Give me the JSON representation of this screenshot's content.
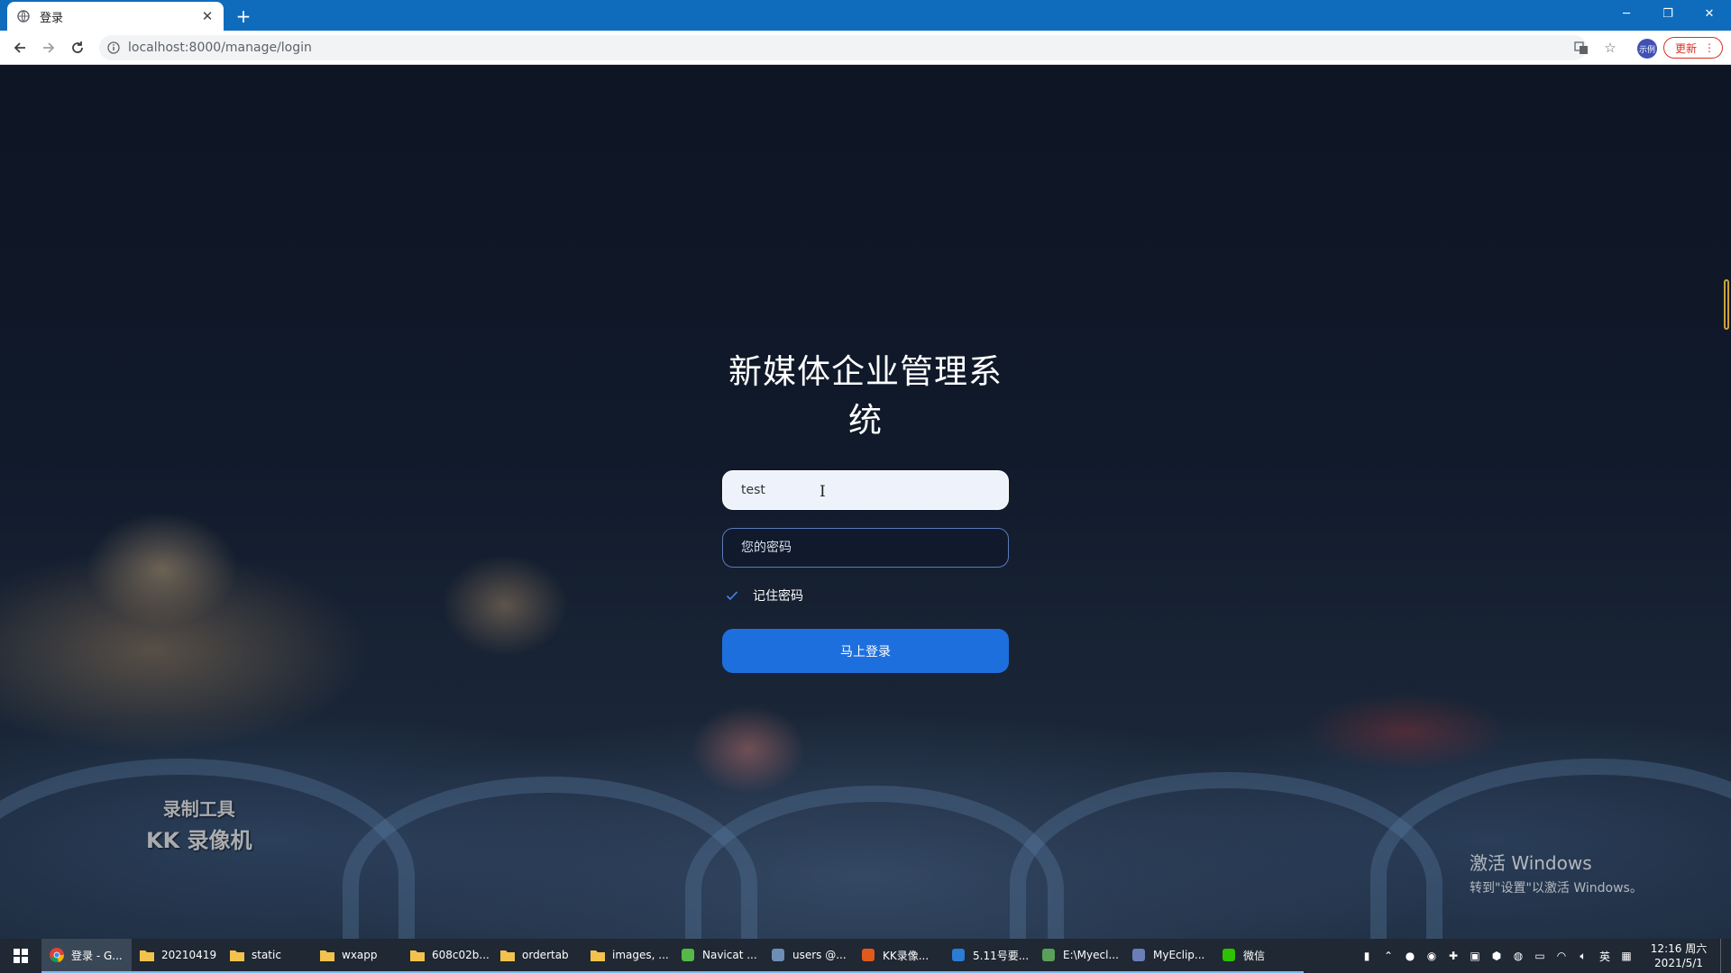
{
  "browser": {
    "tab_title": "登录",
    "tab_close": "✕",
    "new_tab": "+",
    "url": "localhost:8000/manage/login",
    "profile_label": "示例",
    "update_label": "更新",
    "menu_icon": "⋮",
    "window_controls": {
      "minimize": "─",
      "restore": "❐",
      "close": "✕"
    }
  },
  "login": {
    "title": "新媒体企业管理系统",
    "username_value": "test",
    "password_placeholder": "您的密码",
    "remember_label": "记住密码",
    "remember_checked": true,
    "submit_label": "马上登录"
  },
  "overlays": {
    "watermark_line1": "录制工具",
    "watermark_line2": "KK 录像机",
    "activate_title": "激活 Windows",
    "activate_sub": "转到\"设置\"以激活 Windows。"
  },
  "taskbar": {
    "items": [
      {
        "label": "登录 - G...",
        "icon": "chrome-icon",
        "color": "#4285f4",
        "active": true
      },
      {
        "label": "20210419",
        "icon": "folder-icon",
        "color": "#f3c24d",
        "active": false
      },
      {
        "label": "static",
        "icon": "folder-icon",
        "color": "#f3c24d",
        "active": false
      },
      {
        "label": "wxapp",
        "icon": "folder-icon",
        "color": "#f3c24d",
        "active": false
      },
      {
        "label": "608c02b...",
        "icon": "folder-icon",
        "color": "#f3c24d",
        "active": false
      },
      {
        "label": "ordertab",
        "icon": "folder-icon",
        "color": "#f3c24d",
        "active": false
      },
      {
        "label": "images, ...",
        "icon": "folder-icon",
        "color": "#f3c24d",
        "active": false
      },
      {
        "label": "Navicat ...",
        "icon": "navicat-icon",
        "color": "#56b847",
        "active": false
      },
      {
        "label": "users @...",
        "icon": "table-icon",
        "color": "#6e8fb5",
        "active": false
      },
      {
        "label": "KK录像...",
        "icon": "kk-recorder-icon",
        "color": "#e05a1c",
        "active": false
      },
      {
        "label": "5.11号要...",
        "icon": "word-icon",
        "color": "#2b7cd3",
        "active": false
      },
      {
        "label": "E:\\Myecl...",
        "icon": "notepad-icon",
        "color": "#5aa05a",
        "active": false
      },
      {
        "label": "MyEclip...",
        "icon": "myeclipse-icon",
        "color": "#6a7fb8",
        "active": false
      },
      {
        "label": "微信",
        "icon": "wechat-icon",
        "color": "#2dc100",
        "active": false
      }
    ],
    "ime_label": "英",
    "time": "12:16 周六",
    "date": "2021/5/1"
  }
}
